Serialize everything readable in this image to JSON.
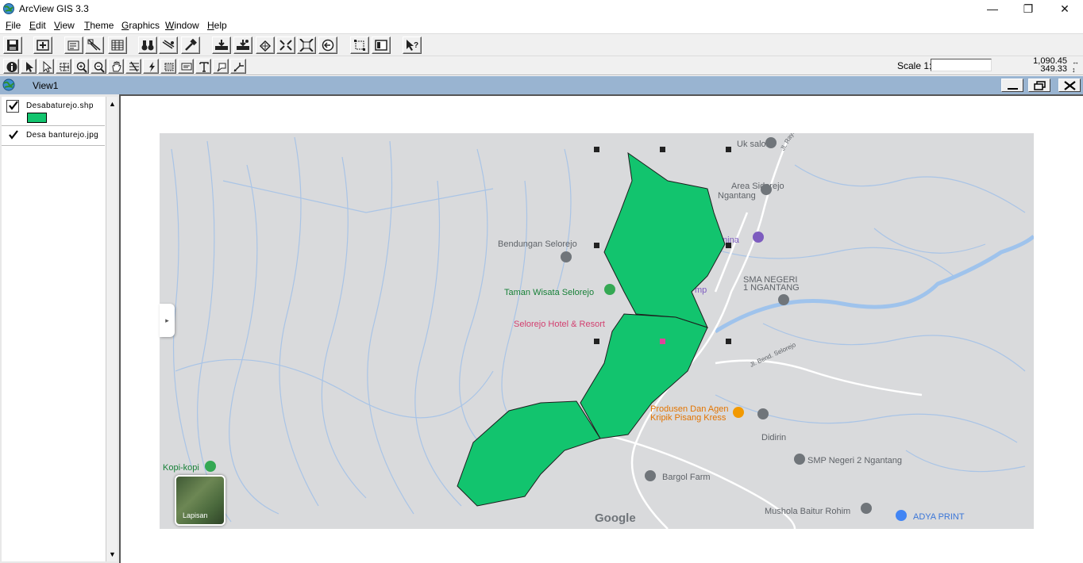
{
  "window": {
    "title": "ArcView GIS 3.3",
    "minimize_glyph": "—",
    "maximize_glyph": "❐",
    "close_glyph": "✕"
  },
  "menu": {
    "items": [
      {
        "label": "File",
        "ul": "F",
        "rest": "ile"
      },
      {
        "label": "Edit",
        "ul": "E",
        "rest": "dit"
      },
      {
        "label": "View",
        "ul": "V",
        "rest": "iew"
      },
      {
        "label": "Theme",
        "ul": "T",
        "rest": "heme"
      },
      {
        "label": "Graphics",
        "ul": "G",
        "rest": "raphics"
      },
      {
        "label": "Window",
        "ul": "W",
        "rest": "indow"
      },
      {
        "label": "Help",
        "ul": "H",
        "rest": "elp"
      }
    ]
  },
  "tools": {
    "scale_label": "Scale 1:",
    "scale_value": "",
    "coord_x": "1,090.45",
    "coord_y": "349.33",
    "coord_arrows": "↔\n↕"
  },
  "view": {
    "title": "View1"
  },
  "toc": {
    "themes": [
      {
        "name": "Desabaturejo.shp",
        "checked": true,
        "symbol_color": "#12c46e"
      },
      {
        "name": "Desa banturejo.jpg",
        "checked": true
      }
    ]
  },
  "map": {
    "polygon_color": "#12c46e",
    "labels": {
      "uk_salon": "Uk salon",
      "sidorejo": "Area Sidorejo",
      "ngantang": "Ngantang",
      "bendungan": "Bendungan Selorejo",
      "taman": "Taman Wisata Selorejo",
      "hotel": "Selorejo Hotel & Resort",
      "sma1": "SMA NEGERI",
      "sma2": "1 NGANTANG",
      "dusun1": "Produsen Dan Agen",
      "dusun2": "Kripik Pisang Kress",
      "didirin": "Didirin",
      "smp": "SMP Negeri 2 Ngantang",
      "bargol": "Bargol Farm",
      "mushola": "Mushola Baitur Rohim",
      "adya": "ADYA PRINT",
      "kopi": "Kopi-kopi",
      "jl_raya": "Jl. Raya",
      "jl_selorejo": "Jl. Bend. Selorejo",
      "mina": "mina",
      "mp": "mp",
      "google": "Google",
      "lapisan": "Lapisan"
    }
  }
}
